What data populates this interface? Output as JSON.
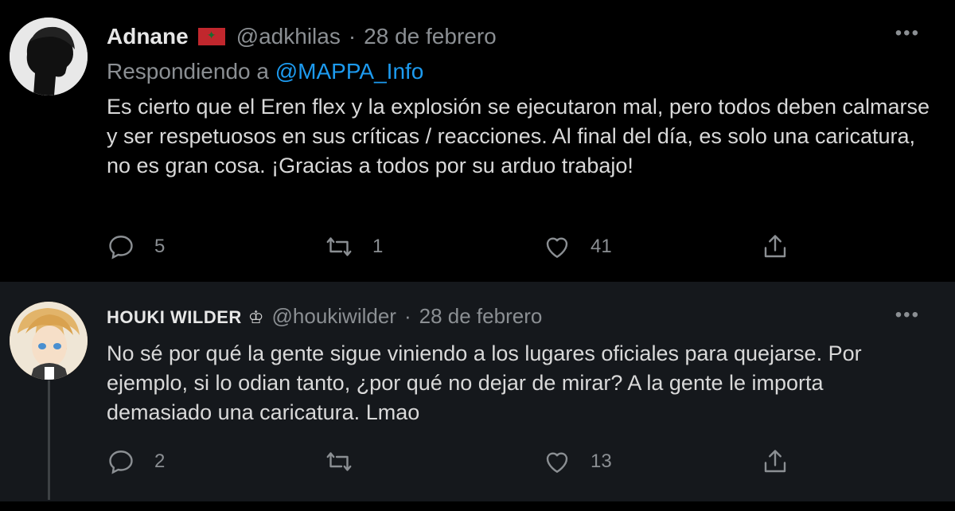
{
  "tweets": [
    {
      "display_name": "Adnane",
      "handle": "@adkhilas",
      "separator": "·",
      "date": "28 de febrero",
      "replying_prefix": "Respondiendo a",
      "replying_to": "@MAPPA_Info",
      "text": "Es cierto que el Eren flex y la explosión se ejecutaron mal, pero todos deben calmarse y ser respetuosos en sus críticas / reacciones. Al final del día, es solo una caricatura, no es gran cosa. ¡Gracias a todos por su arduo trabajo!",
      "more": "•••",
      "replies": "5",
      "retweets": "1",
      "likes": "41",
      "icons": [
        "reply-icon",
        "retweet-icon",
        "like-icon",
        "share-icon"
      ]
    },
    {
      "display_name": "HOUKI WILDER",
      "badge": "♔",
      "handle": "@houkiwilder",
      "separator": "·",
      "date": "28 de febrero",
      "text": "No sé por qué la gente sigue viniendo a los lugares oficiales para quejarse. Por ejemplo, si lo odian tanto, ¿por qué no dejar de mirar? A la gente le importa demasiado una caricatura. Lmao",
      "more": "•••",
      "replies": "2",
      "retweets": "",
      "likes": "13",
      "icons": [
        "reply-icon",
        "retweet-icon",
        "like-icon",
        "share-icon"
      ]
    }
  ],
  "colors": {
    "background": "#000000",
    "reply_background": "#15181c",
    "link": "#1d9bf0",
    "muted": "#8b8f93"
  }
}
